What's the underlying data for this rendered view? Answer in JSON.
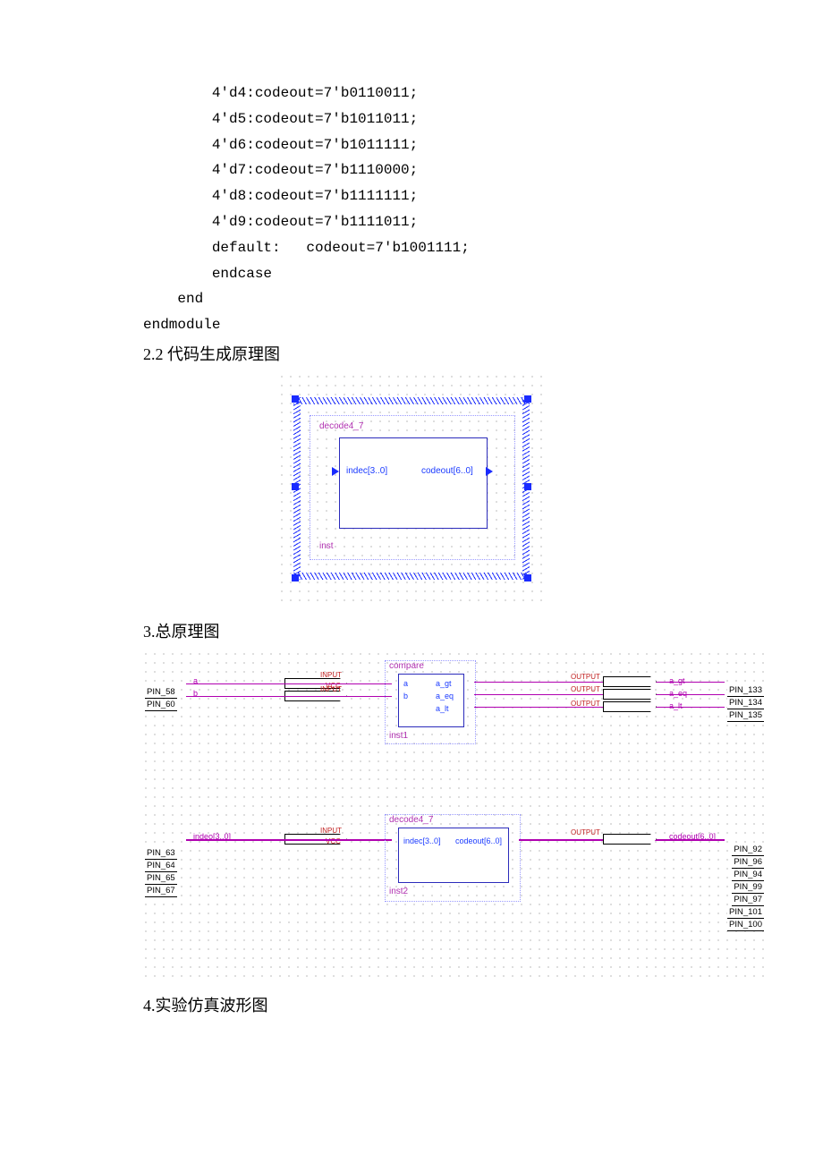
{
  "code": {
    "l1": "4'd4:codeout=7'b0110011;",
    "l2": "4'd5:codeout=7'b1011011;",
    "l3": "4'd6:codeout=7'b1011111;",
    "l4": "4'd7:codeout=7'b1110000;",
    "l5": "4'd8:codeout=7'b1111111;",
    "l6": "4'd9:codeout=7'b1111011;",
    "l7": "default:   codeout=7'b1001111;",
    "l8": "endcase",
    "l9": "end",
    "l10": "endmodule"
  },
  "headings": {
    "h22": "2.2 代码生成原理图",
    "h3": "3.总原理图",
    "h4": "4.实验仿真波形图"
  },
  "sch1": {
    "module": "decode4_7",
    "inst": "inst",
    "port_in": "indec[3..0]",
    "port_out": "codeout[6..0]"
  },
  "sch2": {
    "compare": {
      "name": "compare",
      "inst": "inst1",
      "in_a": "a",
      "in_b": "b",
      "out_gt": "a_gt",
      "out_eq": "a_eq",
      "out_lt": "a_lt"
    },
    "decode": {
      "name": "decode4_7",
      "inst": "inst2",
      "in": "indec[3..0]",
      "out": "codeout[6..0]"
    },
    "sig": {
      "a": "a",
      "b": "b",
      "indec": "indeo[3..0]",
      "a_gt": "a_gt",
      "a_eq": "a_eq",
      "a_lt": "a_lt",
      "codeout": "codeout[6..0]"
    },
    "io": {
      "input": "INPUT",
      "vcc": "VCC",
      "output": "OUTPUT"
    },
    "pins_left_top": [
      "PIN_58",
      "PIN_60"
    ],
    "pins_left_bot": [
      "PIN_63",
      "PIN_64",
      "PIN_65",
      "PIN_67"
    ],
    "pins_right_top": [
      "PIN_133",
      "PIN_134",
      "PIN_135"
    ],
    "pins_right_bot": [
      "PIN_92",
      "PIN_96",
      "PIN_94",
      "PIN_99",
      "PIN_97",
      "PIN_101",
      "PIN_100"
    ]
  }
}
